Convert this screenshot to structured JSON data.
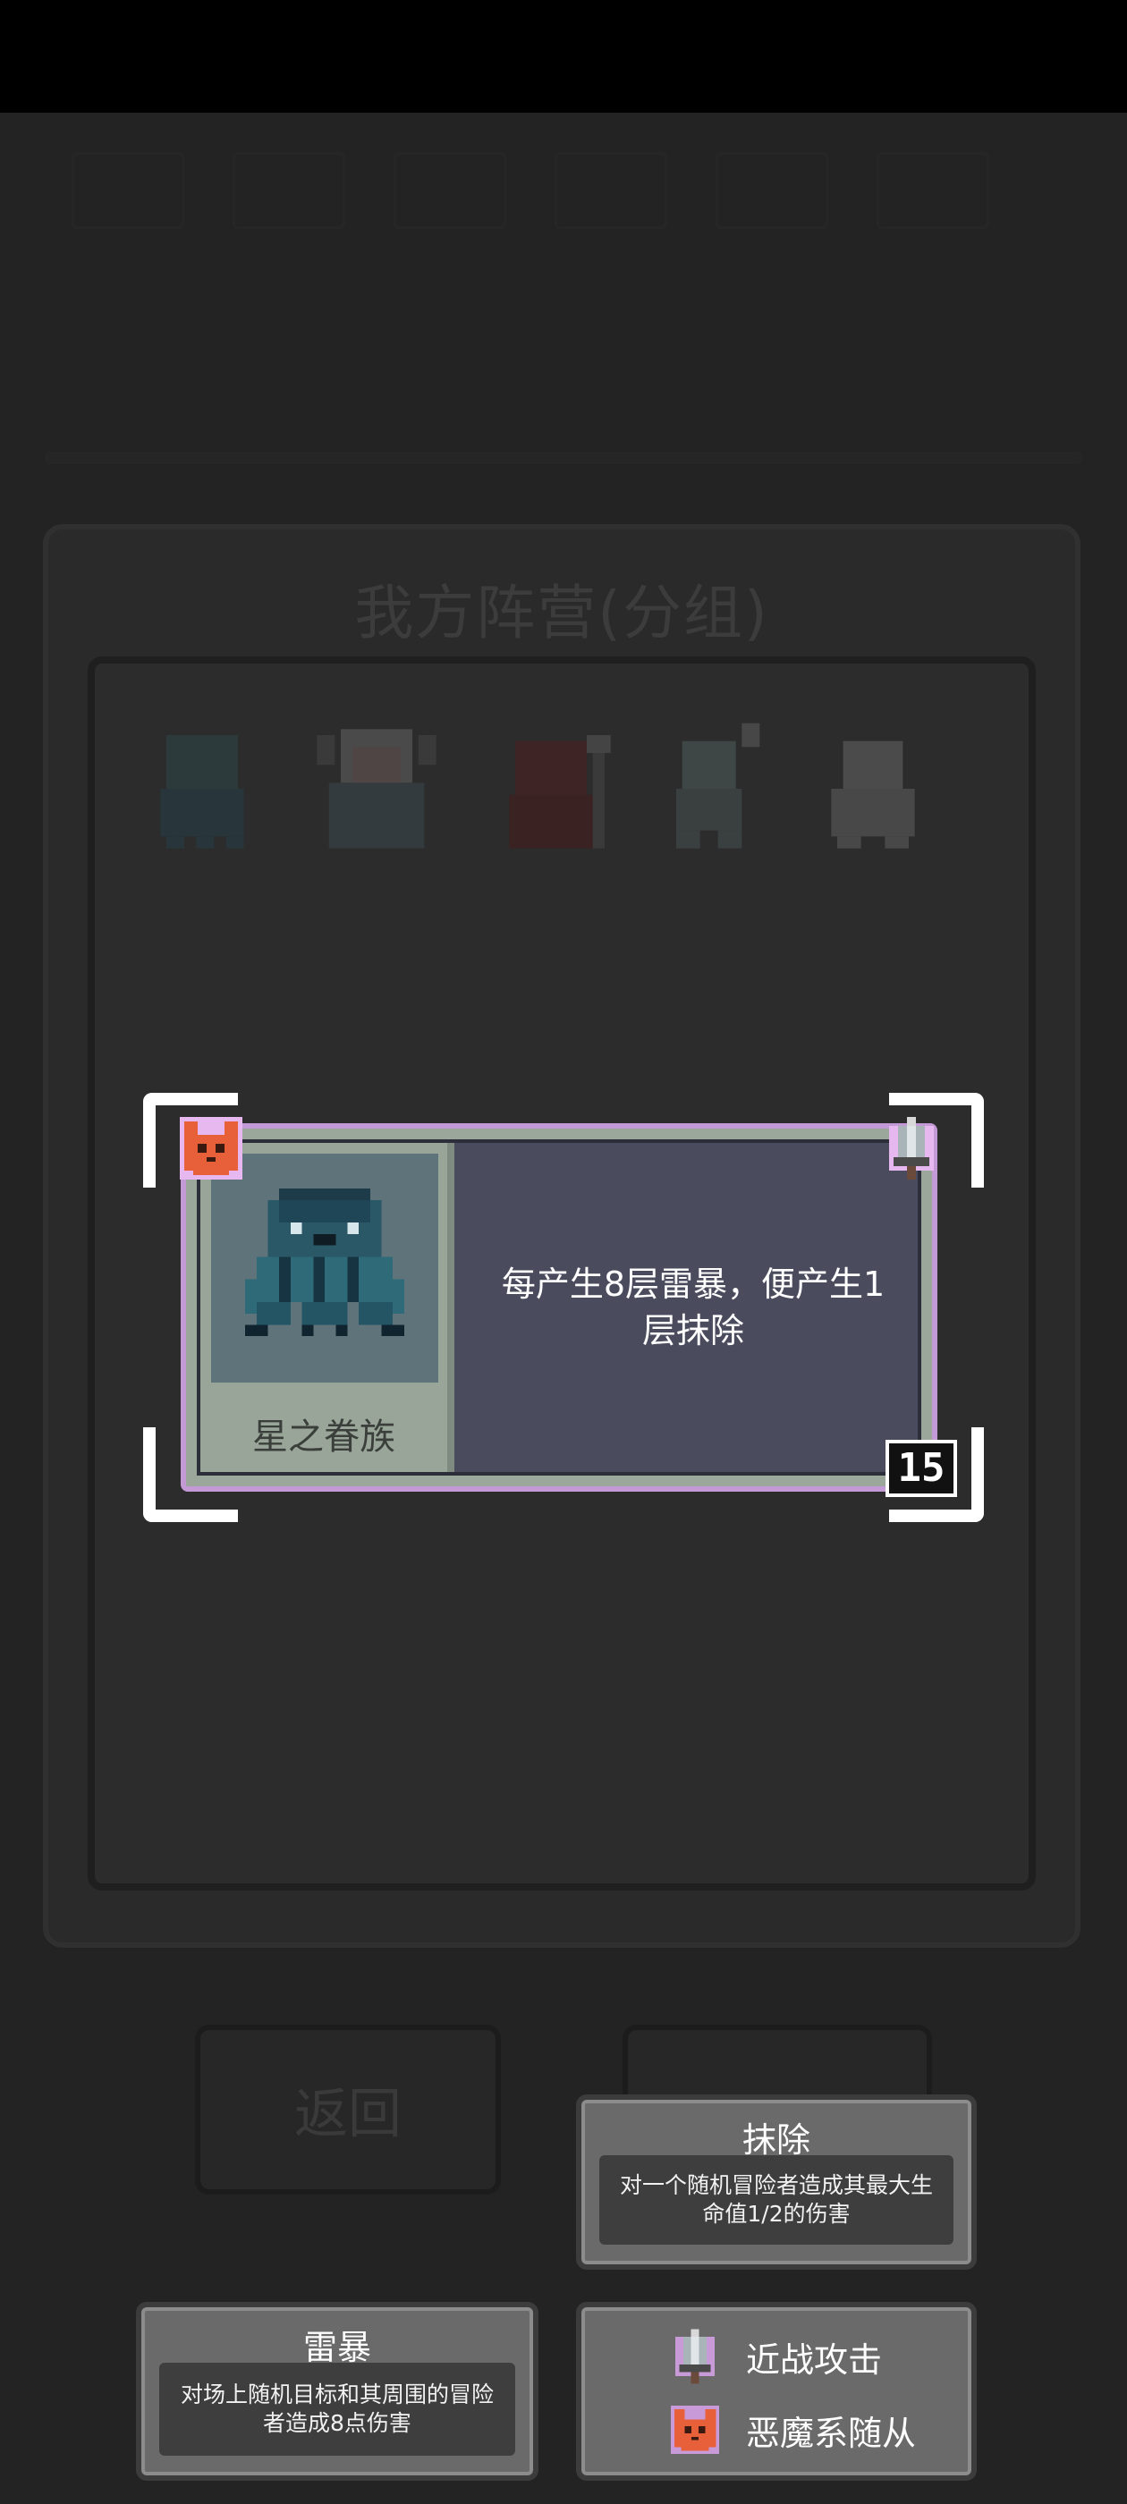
{
  "background_panel": {
    "title": "我方阵营(分组)",
    "back_button_label": "返回"
  },
  "selected_minion": {
    "name": "星之眷族",
    "description": "每产生8层雷暴，便产生1层抹除",
    "level": "15",
    "portrait_icon": "star-spawn-tentacle-creature-icon",
    "type_icon": "demon-fox-icon",
    "attack_icon": "sword-icon"
  },
  "tooltips": {
    "erase": {
      "title": "抹除",
      "body": "对一个随机冒险者造成其最大生命值1/2的伤害"
    },
    "thunderstorm": {
      "title": "雷暴",
      "body": "对场上随机目标和其周围的冒险者造成8点伤害"
    },
    "tags": {
      "melee": "近战攻击",
      "demon": "恶魔系随从"
    }
  },
  "colors": {
    "card_border": "#c49ad6",
    "fox_orange": "#e8603a",
    "portrait_bg": "#5f737a"
  }
}
